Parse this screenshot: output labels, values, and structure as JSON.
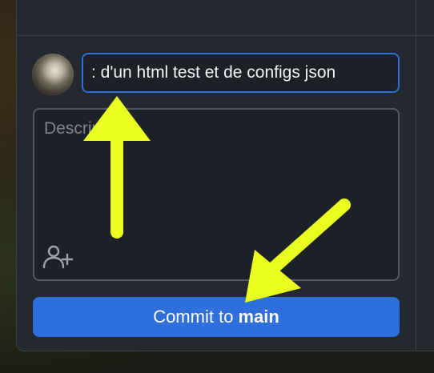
{
  "commit_panel": {
    "summary_value": ": d'un html test et de configs json",
    "description_placeholder": "Description",
    "commit_button": {
      "prefix": "Commit to",
      "branch": "main"
    }
  },
  "icons": {
    "avatar": "user-avatar",
    "coauthor": "add-coauthor-icon"
  },
  "colors": {
    "panel_bg": "#24292f",
    "input_bg": "#1d2127",
    "accent_blue": "#2f6fdc",
    "annotation_arrow": "#e8ff1f"
  }
}
